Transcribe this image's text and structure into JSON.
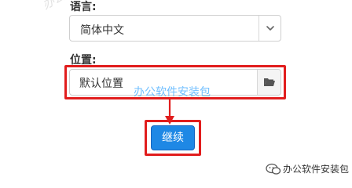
{
  "watermark": {
    "top_text": "办公",
    "center_text": "办公软件安装包",
    "corner_text": "办公软件安装包"
  },
  "language": {
    "label": "语言:",
    "selected": "简体中文"
  },
  "location": {
    "label": "位置:",
    "value": "默认位置"
  },
  "actions": {
    "continue_label": "继续"
  },
  "colors": {
    "accent": "#1e88e5",
    "highlight": "#e11d1d"
  },
  "icons": {
    "dropdown": "chevron-down-icon",
    "browse": "folder-icon",
    "pointer": "arrow-down-icon",
    "wechat": "wechat-icon"
  }
}
